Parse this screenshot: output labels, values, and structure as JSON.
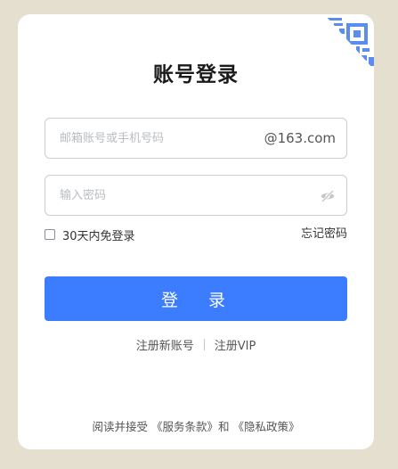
{
  "login": {
    "title": "账号登录",
    "account": {
      "placeholder": "邮箱账号或手机号码",
      "value": "",
      "domain_suffix": "@163.com"
    },
    "password": {
      "placeholder": "输入密码",
      "value": "",
      "toggle_icon": "eye-hidden-icon"
    },
    "remember_label": "30天内免登录",
    "remember_checked": false,
    "forgot_label": "忘记密码",
    "login_button": "登 录",
    "register_label": "注册新账号",
    "register_vip_label": "注册VIP",
    "qr_icon": "qr-code-icon",
    "agreement": {
      "prefix": "阅读并接受",
      "terms": "《服务条款》",
      "and": "和",
      "privacy": "《隐私政策》"
    }
  },
  "colors": {
    "background": "#e5dfd0",
    "card": "#ffffff",
    "primary": "#3c7cff",
    "qr_blue": "#5b8dee"
  }
}
